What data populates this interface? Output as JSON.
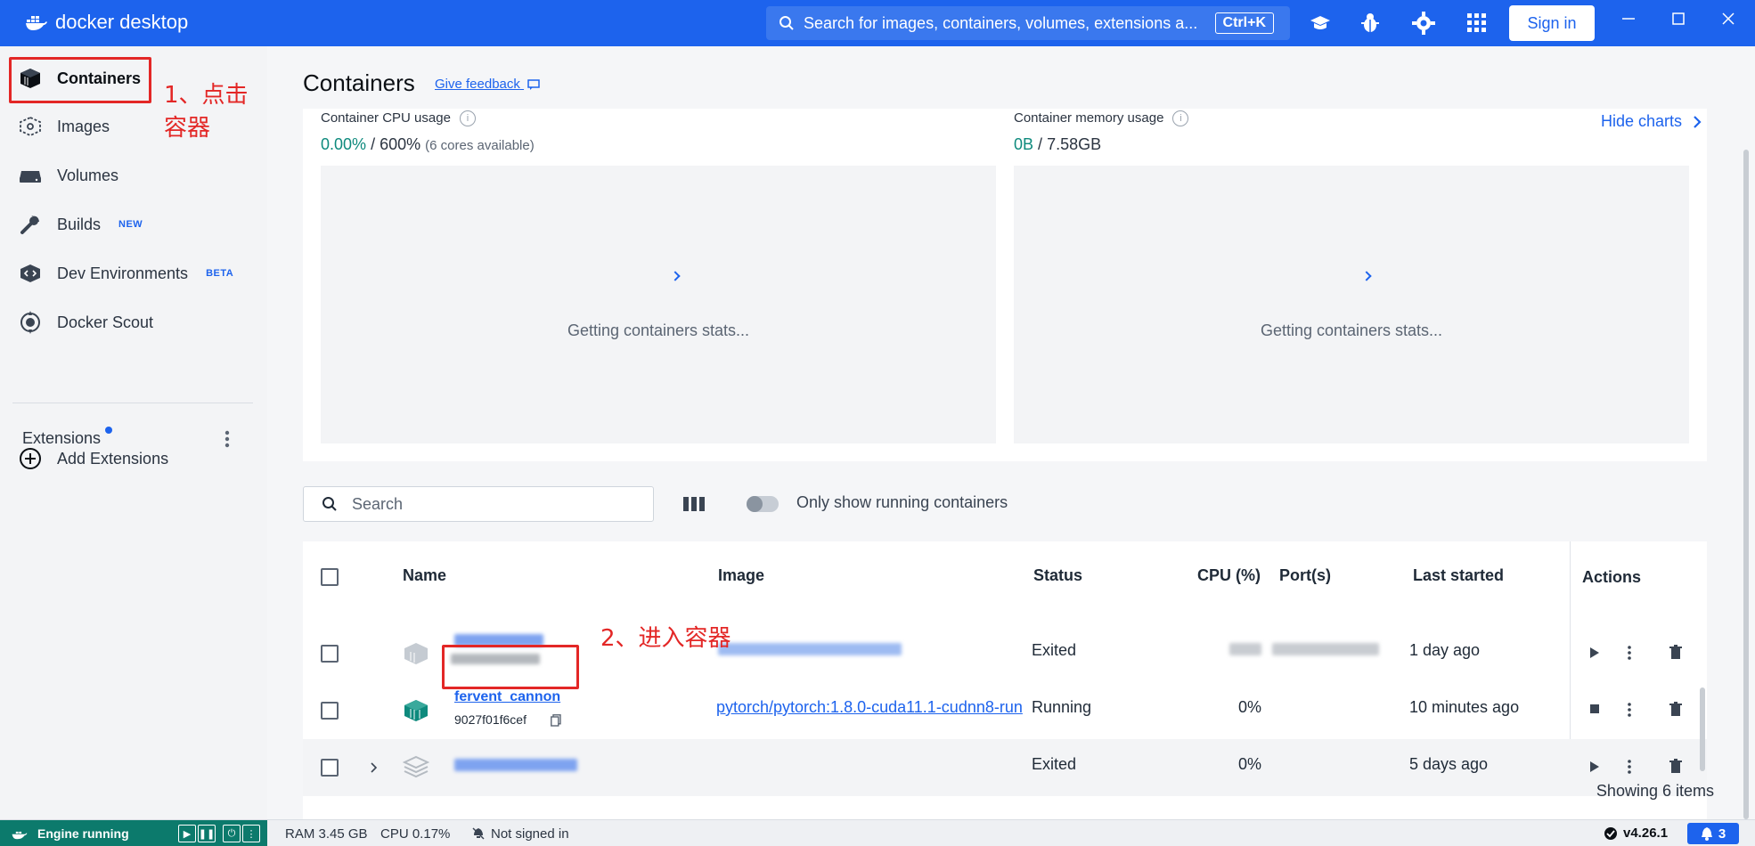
{
  "app": {
    "brand": "docker desktop",
    "search_placeholder": "Search for images, containers, volumes, extensions a...",
    "search_shortcut": "Ctrl+K",
    "sign_in_label": "Sign in",
    "accent_color": "#1d63ed"
  },
  "sidebar": {
    "items": [
      {
        "label": "Containers",
        "icon": "containers-icon",
        "tag": ""
      },
      {
        "label": "Images",
        "icon": "images-icon",
        "tag": ""
      },
      {
        "label": "Volumes",
        "icon": "volumes-icon",
        "tag": ""
      },
      {
        "label": "Builds",
        "icon": "builds-icon",
        "tag": "NEW"
      },
      {
        "label": "Dev Environments",
        "icon": "dev-environments-icon",
        "tag": "BETA"
      },
      {
        "label": "Docker Scout",
        "icon": "docker-scout-icon",
        "tag": ""
      }
    ],
    "extensions_title": "Extensions",
    "add_extensions_label": "Add Extensions"
  },
  "annotations": {
    "step1": "1、点击容器",
    "step2": "2、进入容器"
  },
  "main": {
    "title": "Containers",
    "feedback_label": "Give feedback",
    "hide_charts_label": "Hide charts",
    "cpu": {
      "label": "Container CPU usage",
      "used": "0.00%",
      "sep": "/",
      "total": "600%",
      "note": "(6 cores available)",
      "status": "Getting containers stats..."
    },
    "memory": {
      "label": "Container memory usage",
      "used": "0B",
      "sep": "/",
      "total": "7.58GB",
      "status": "Getting containers stats..."
    },
    "search_placeholder": "Search",
    "only_running_label": "Only show running containers",
    "table": {
      "headers": {
        "name": "Name",
        "image": "Image",
        "status": "Status",
        "cpu": "CPU (%)",
        "ports": "Port(s)",
        "last_started": "Last started",
        "actions": "Actions"
      },
      "rows": [
        {
          "name": "",
          "id": "",
          "image": "",
          "status": "Exited",
          "cpu": "",
          "last_started": "1 day ago"
        },
        {
          "name": "fervent_cannon",
          "id": "9027f01f6cef",
          "image": "pytorch/pytorch:1.8.0-cuda11.1-cudnn8-run",
          "status": "Running",
          "cpu": "0%",
          "last_started": "10 minutes ago"
        },
        {
          "name": "",
          "id": "",
          "image": "",
          "status": "Exited",
          "cpu": "0%",
          "last_started": "5 days ago"
        }
      ],
      "showing": "Showing 6 items"
    }
  },
  "footer": {
    "engine_status": "Engine running",
    "ram": "RAM 3.45 GB",
    "cpu": "CPU 0.17%",
    "signed_in": "Not signed in",
    "version": "v4.26.1",
    "notifications": "3"
  }
}
